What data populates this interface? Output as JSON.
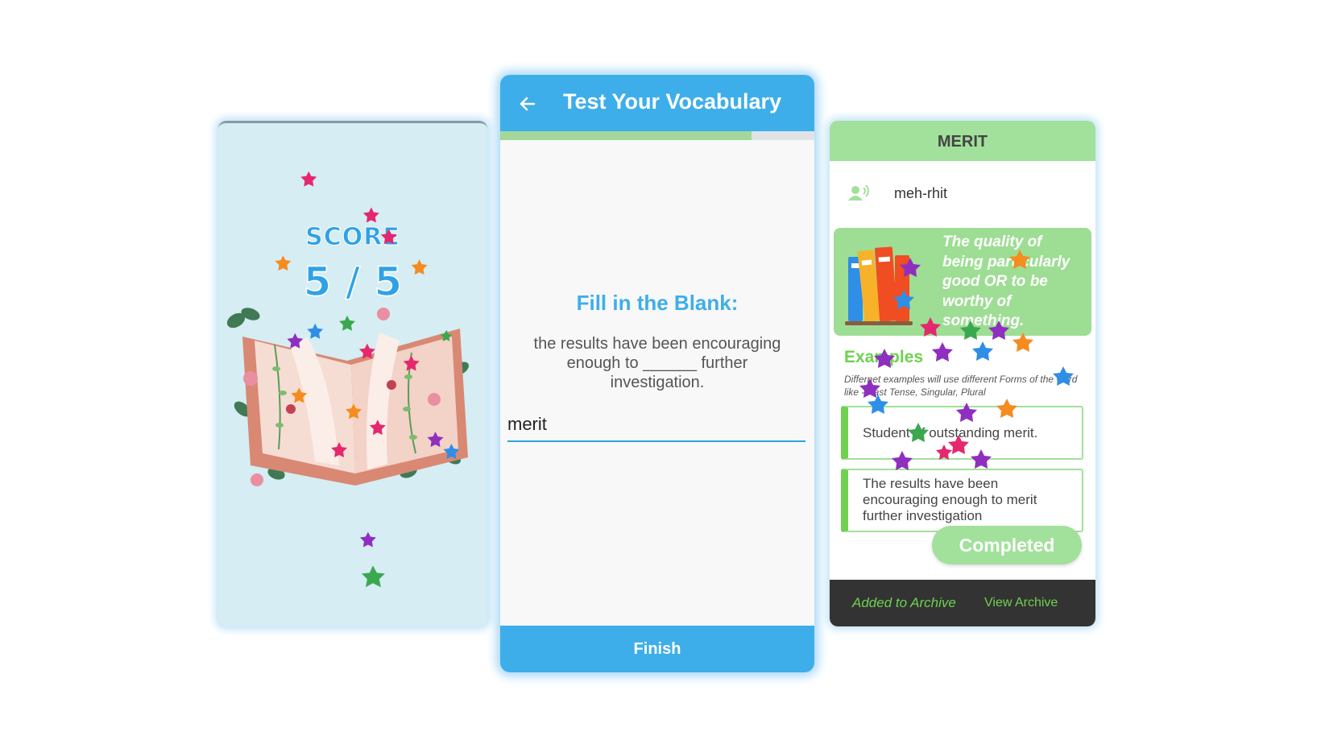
{
  "score_screen": {
    "label": "SCORE",
    "value": "5 / 5"
  },
  "quiz_screen": {
    "title": "Test Your Vocabulary",
    "progress": 0.8,
    "question_type": "Fill in the Blank:",
    "question": "the results have been encouraging enough to ______ further investigation.",
    "answer": "merit",
    "finish_label": "Finish"
  },
  "word_screen": {
    "word": "MERIT",
    "pronunciation": "meh-rhit",
    "definition": "The quality of being particularly good OR to be worthy of something.",
    "examples_title": "Examples",
    "examples_subtitle": "Differnet examples will use different Forms of the word like - Past Tense, Singular, Plural",
    "examples": [
      "Student of outstanding merit.",
      "The results have been encouraging enough to merit further investigation"
    ],
    "completed_label": "Completed",
    "archive_message": "Added to Archive",
    "archive_link": "View Archive"
  },
  "colors": {
    "blue": "#3eaeea",
    "green": "#a1e19b",
    "dark_green": "#6fd150",
    "dark_bar": "#333333"
  },
  "icons": [
    "back-arrow-icon",
    "speaker-person-icon",
    "books-icon",
    "confetti-star-icon",
    "open-book-illustration"
  ]
}
